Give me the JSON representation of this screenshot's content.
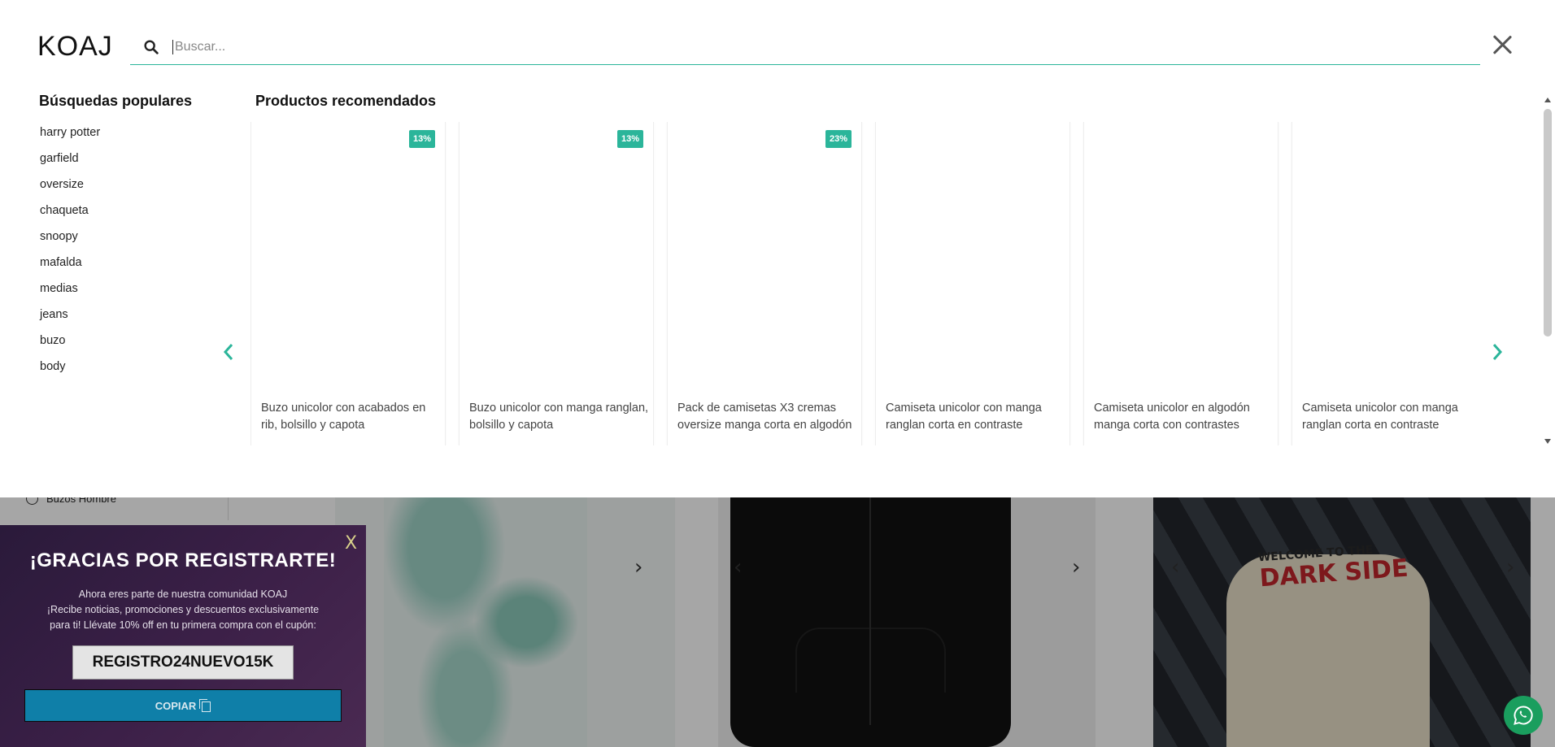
{
  "header": {
    "logo": "KOAJ",
    "search_placeholder": "Buscar..."
  },
  "popular": {
    "title": "Búsquedas populares",
    "items": [
      "harry potter",
      "garfield",
      "oversize",
      "chaqueta",
      "snoopy",
      "mafalda",
      "medias",
      "jeans",
      "buzo",
      "body"
    ]
  },
  "recommended": {
    "title": "Productos recomendados",
    "products": [
      {
        "name": "Buzo unicolor con acabados en rib, bolsillo y capota",
        "badge": "13%"
      },
      {
        "name": "Buzo unicolor con manga ranglan, bolsillo y capota",
        "badge": "13%"
      },
      {
        "name": "Pack de camisetas X3 cremas oversize manga corta en algodón",
        "badge": "23%"
      },
      {
        "name": "Camiseta unicolor con manga ranglan corta en contraste",
        "badge": ""
      },
      {
        "name": "Camiseta unicolor en algodón manga corta con contrastes",
        "badge": ""
      },
      {
        "name": "Camiseta unicolor con manga ranglan corta en contraste",
        "badge": ""
      }
    ]
  },
  "background": {
    "filter_label": "Buzos Hombre",
    "tee_line1": "WELCOME TO THE",
    "tee_line2": "DARK SIDE"
  },
  "popup": {
    "close": "X",
    "title": "¡GRACIAS POR REGISTRARTE!",
    "line1": "Ahora eres parte de nuestra comunidad KOAJ",
    "line2": "¡Recibe noticias, promociones y descuentos exclusivamente",
    "line3": "para ti! Llévate 10% off en tu primera compra con el cupón:",
    "coupon": "REGISTRO24NUEVO15K",
    "copy_label": "COPIAR"
  },
  "colors": {
    "accent": "#2bb59a",
    "popup_bg": "#3c2048",
    "copy_button": "#0f7fa8",
    "whatsapp": "#1a9e5e"
  },
  "icons": {
    "search": "search-icon",
    "close": "close-icon",
    "prev": "chevron-left-icon",
    "next": "chevron-right-icon",
    "copy": "copy-icon",
    "whatsapp": "whatsapp-icon"
  }
}
